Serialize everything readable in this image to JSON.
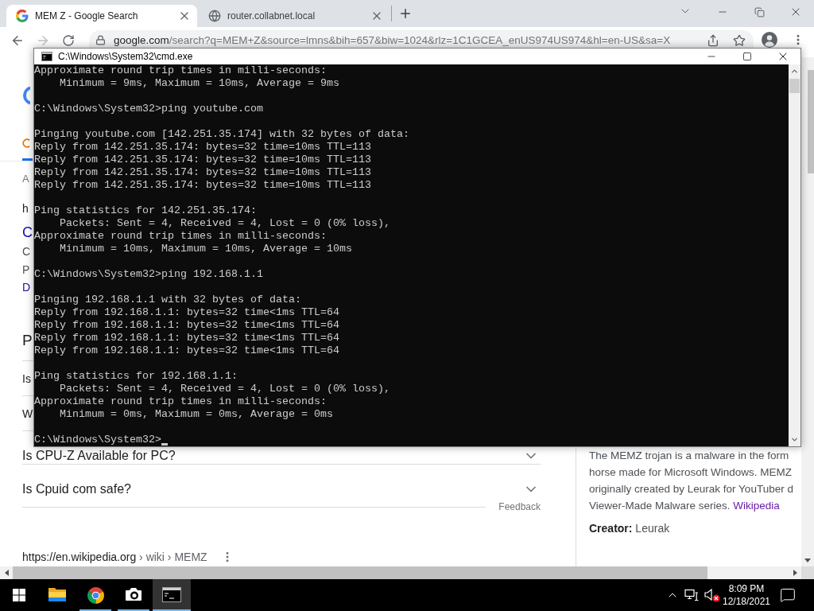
{
  "browser": {
    "tabs": [
      {
        "kind": "google",
        "title": "MEM Z - Google Search",
        "selected": true
      },
      {
        "kind": "globe",
        "title": "router.collabnet.local",
        "selected": false
      }
    ],
    "navigation": {
      "forward_disabled": true
    },
    "address_bar": {
      "host": "google.com",
      "path": "/search?q=MEM+Z&source=lmns&bih=657&biw=1024&rlz=1C1GCEA_enUS974US974&hl=en-US&sa=X"
    },
    "page": {
      "left_edge_fragments": [
        {
          "kind": "count",
          "text": "A"
        },
        {
          "kind": "url",
          "text": "h"
        },
        {
          "kind": "title",
          "text": "C"
        },
        {
          "kind": "snippet",
          "text": "C"
        },
        {
          "kind": "snippet",
          "text": "P"
        },
        {
          "kind": "sitelink",
          "text": "D"
        },
        {
          "kind": "heading",
          "text": "P"
        },
        {
          "kind": "question",
          "text": "Is"
        },
        {
          "kind": "question",
          "text": "W"
        }
      ],
      "questions": [
        {
          "text": "Is CPU-Z Available for PC?",
          "expanded": false
        },
        {
          "text": "Is Cpuid com safe?",
          "expanded": false
        }
      ],
      "feedback": "Feedback",
      "result_url": {
        "site": "https://en.wikipedia.org",
        "path": "› wiki › MEMZ"
      },
      "knowledge_panel": {
        "lines": [
          "The MEMZ trojan is a malware in the form",
          "horse made for Microsoft Windows. MEMZ",
          "originally created by Leurak for YouTuber d",
          "Viewer-Made Malware series."
        ],
        "source": "Wikipedia",
        "facts": [
          "**Creator:** Leurak"
        ]
      }
    }
  },
  "console_window": {
    "title": "C:\\Windows\\System32\\cmd.exe",
    "output_blocks": [
      [
        "Approximate round trip times in milli-seconds:",
        "    Minimum = 9ms, Maximum = 10ms, Average = 9ms"
      ],
      [
        "C:\\Windows\\System32>ping youtube.com"
      ],
      [
        "Pinging youtube.com [142.251.35.174] with 32 bytes of data:",
        "Reply from 142.251.35.174: bytes=32 time=10ms TTL=113",
        "Reply from 142.251.35.174: bytes=32 time=10ms TTL=113",
        "Reply from 142.251.35.174: bytes=32 time=10ms TTL=113",
        "Reply from 142.251.35.174: bytes=32 time=10ms TTL=113"
      ],
      [
        "Ping statistics for 142.251.35.174:",
        "    Packets: Sent = 4, Received = 4, Lost = 0 (0% loss),",
        "Approximate round trip times in milli-seconds:",
        "    Minimum = 10ms, Maximum = 10ms, Average = 10ms"
      ],
      [
        "C:\\Windows\\System32>ping 192.168.1.1"
      ],
      [
        "Pinging 192.168.1.1 with 32 bytes of data:",
        "Reply from 192.168.1.1: bytes=32 time<1ms TTL=64",
        "Reply from 192.168.1.1: bytes=32 time<1ms TTL=64",
        "Reply from 192.168.1.1: bytes=32 time<1ms TTL=64",
        "Reply from 192.168.1.1: bytes=32 time<1ms TTL=64"
      ],
      [
        "Ping statistics for 192.168.1.1:",
        "    Packets: Sent = 4, Received = 4, Lost = 0 (0% loss),",
        "Approximate round trip times in milli-seconds:",
        "    Minimum = 0ms, Maximum = 0ms, Average = 0ms"
      ]
    ],
    "prompt": "C:\\Windows\\System32>"
  },
  "taskbar": {
    "apps": [
      {
        "kind": "folder",
        "running": false,
        "selected": false
      },
      {
        "kind": "browser",
        "running": true,
        "selected": false
      },
      {
        "kind": "camera",
        "running": true,
        "selected": false
      },
      {
        "kind": "terminal",
        "running": true,
        "selected": true
      }
    ],
    "tray": {
      "volume_muted": true,
      "time": "8:09 PM",
      "date": "12/18/2021"
    }
  }
}
